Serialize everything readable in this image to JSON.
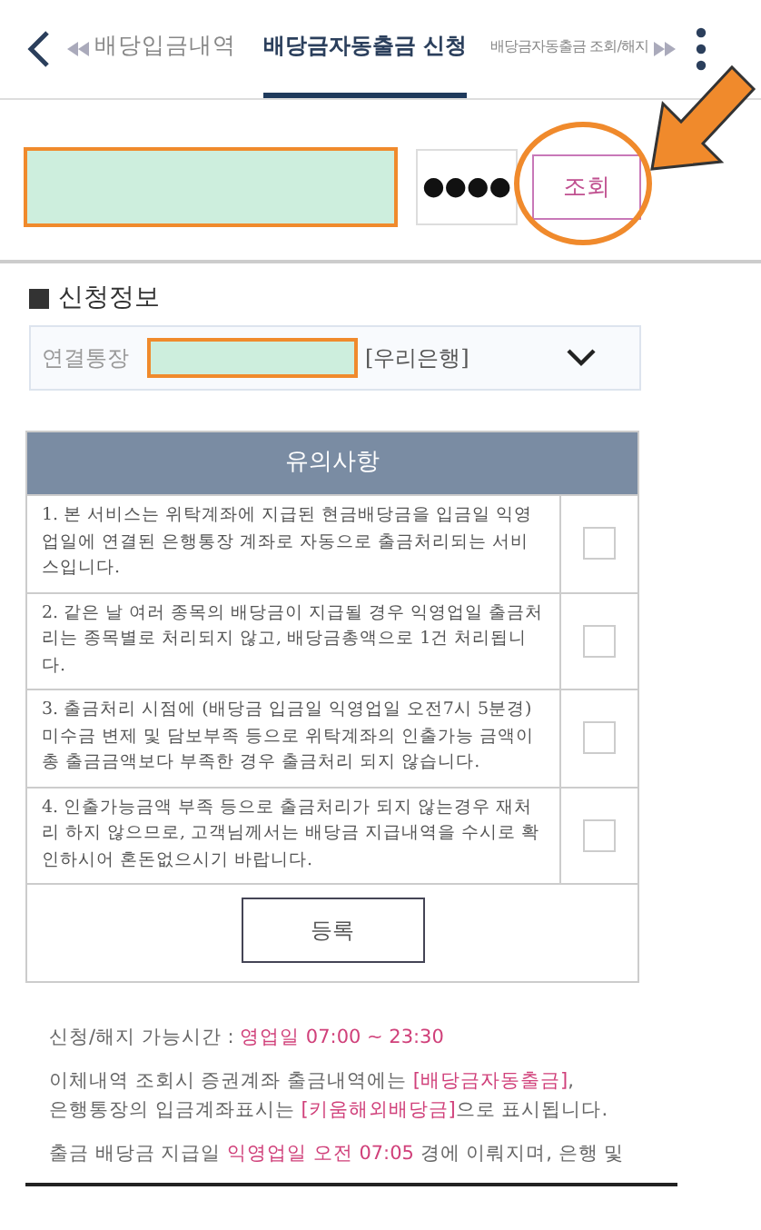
{
  "tabs": [
    {
      "label": "배당입금내역",
      "selected": false
    },
    {
      "label": "배당금자동출금 신청",
      "selected": true
    },
    {
      "label": "배당금자동출금 조회/해지",
      "selected": false
    }
  ],
  "login": {
    "password": "●●●●",
    "button": "조회"
  },
  "section_title": "신청정보",
  "account": {
    "label": "연결통장",
    "bank": "[우리은행]"
  },
  "notice": {
    "title": "유의사항",
    "items": [
      {
        "text": "1. 본 서비스는 위탁계좌에 지급된 현금배당금을 입금일 익영업일에 연결된 은행통장 계좌로 자동으로 출금처리되는 서비스입니다.",
        "checked": false
      },
      {
        "text": "2. 같은 날 여러 종목의 배당금이 지급될 경우 익영업일 출금처리는 종목별로 처리되지 않고, 배당금총액으로 1건 처리됩니다.",
        "checked": false
      },
      {
        "text": "3. 출금처리 시점에 (배당금 입금일 익영업일 오전7시 5분경) 미수금 변제 및 담보부족 등으로 위탁계좌의 인출가능 금액이 총 출금금액보다 부족한 경우 출금처리 되지 않습니다.",
        "checked": false
      },
      {
        "text": "4. 인출가능금액 부족 등으로 출금처리가 되지 않는경우 재처리 하지 않으므로, 고객님께서는 배당금 지급내역을 수시로 확인하시어 혼돈없으시기 바랍니다.",
        "checked": false
      }
    ],
    "button": "등록"
  },
  "notes": [
    "신청/해지 가능시간 : **영업일 07:00 ~ 23:30**",
    "이체내역 조회시 증권계좌 출금내역에는 **[배당금자동출금]**,\n은행통장의 입금계좌표시는 **[키움해외배당금]**으로 표시됩니다.",
    "출금 배당금 지급일 **익영업일 오전 07:05** 경에 이뤄지며, 은행 및"
  ]
}
